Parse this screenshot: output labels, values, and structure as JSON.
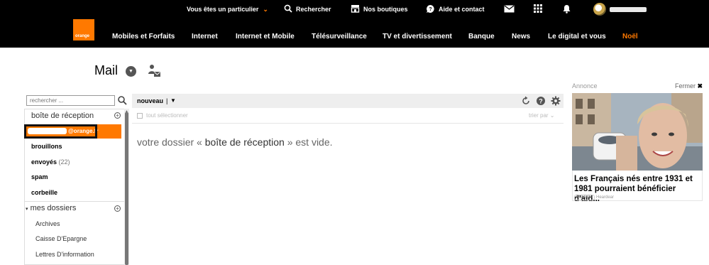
{
  "topbar": {
    "particulier_label": "Vous êtes un particulier",
    "search_label": "Rechercher",
    "shops_label": "Nos boutiques",
    "help_label": "Aide et contact"
  },
  "brand": {
    "logo_text": "orange",
    "accent_color": "#ff7900"
  },
  "nav": {
    "items": [
      "Mobiles et Forfaits",
      "Internet",
      "Internet et Mobile",
      "Télésurveillance",
      "TV et divertissement",
      "Banque",
      "News",
      "Le digital et vous",
      "Noël"
    ]
  },
  "mail": {
    "title": "Mail"
  },
  "sidebar": {
    "search_placeholder": "rechercher ...",
    "inbox_section": "boîte de réception",
    "account_suffix": "@orange.fr",
    "folders": {
      "drafts": "brouillons",
      "sent": "envoyés",
      "sent_count": "(22)",
      "spam": "spam",
      "trash": "corbeille"
    },
    "my_folders": "mes dossiers",
    "subfolders": [
      "Archives",
      "Caisse D'Epargne",
      "Lettres D'information"
    ]
  },
  "list": {
    "new_button": "nouveau",
    "select_label": "tout sélectionner",
    "sort_label": "trier par",
    "empty_prefix": "votre dossier « ",
    "empty_folder": "boîte de réception",
    "empty_suffix": " » est vide."
  },
  "ad": {
    "label": "Annonce",
    "close_label": "Fermer",
    "title": "Les Français nés entre 1931 et\n1981 pourraient bénéficier d'aid...",
    "badge": "Publicité",
    "source": "Heardear"
  }
}
